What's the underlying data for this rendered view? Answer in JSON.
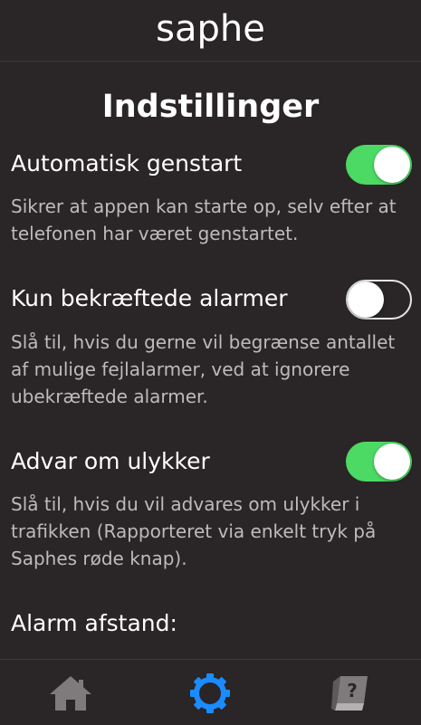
{
  "app": {
    "logo_text": "saphe"
  },
  "page": {
    "title": "Indstillinger"
  },
  "settings": [
    {
      "label": "Automatisk genstart",
      "description": "Sikrer at appen kan starte op, selv efter at telefonen har været genstartet.",
      "enabled": true
    },
    {
      "label": "Kun bekræftede alarmer",
      "description": "Slå til, hvis du gerne vil begrænse antallet af mulige fejlalarmer, ved at ignorere ubekræftede alarmer.",
      "enabled": false
    },
    {
      "label": "Advar om ulykker",
      "description": "Slå til, hvis du vil advares om ulykker i trafikken (Rapporteret via enkelt tryk på Saphes røde knap).",
      "enabled": true
    },
    {
      "label": "Alarm afstand:"
    }
  ],
  "navbar": {
    "items": [
      {
        "icon": "home-icon",
        "active": false
      },
      {
        "icon": "gear-icon",
        "active": true
      },
      {
        "icon": "help-book-icon",
        "active": false
      }
    ]
  },
  "colors": {
    "background": "#2a2526",
    "toggle_on": "#4cd964",
    "nav_active": "#1a8cff",
    "nav_inactive": "#7f7b7c",
    "description_text": "#bdbcbc"
  }
}
